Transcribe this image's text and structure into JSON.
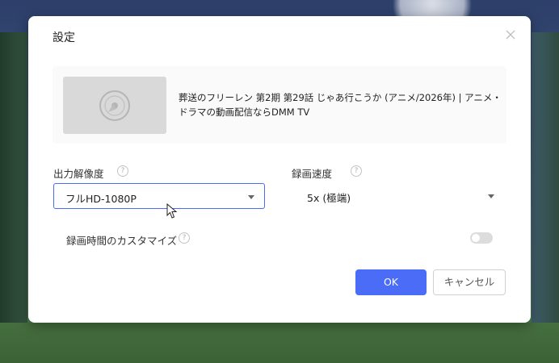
{
  "dialog": {
    "title": "設定",
    "close_icon": "close-icon"
  },
  "media": {
    "thumbnail_icon": "disc-icon",
    "title": "葬送のフリーレン 第2期 第29話 じゃあ行こうか (アニメ/2026年) | アニメ・ドラマの動画配信ならDMM TV"
  },
  "resolution": {
    "label": "出力解像度",
    "value": "フルHD-1080P"
  },
  "speed": {
    "label": "録画速度",
    "value": "5x (極端)"
  },
  "custom_time": {
    "label": "録画時間のカスタマイズ",
    "enabled": false
  },
  "buttons": {
    "ok": "OK",
    "cancel": "キャンセル"
  },
  "colors": {
    "accent": "#4a6cf7"
  }
}
